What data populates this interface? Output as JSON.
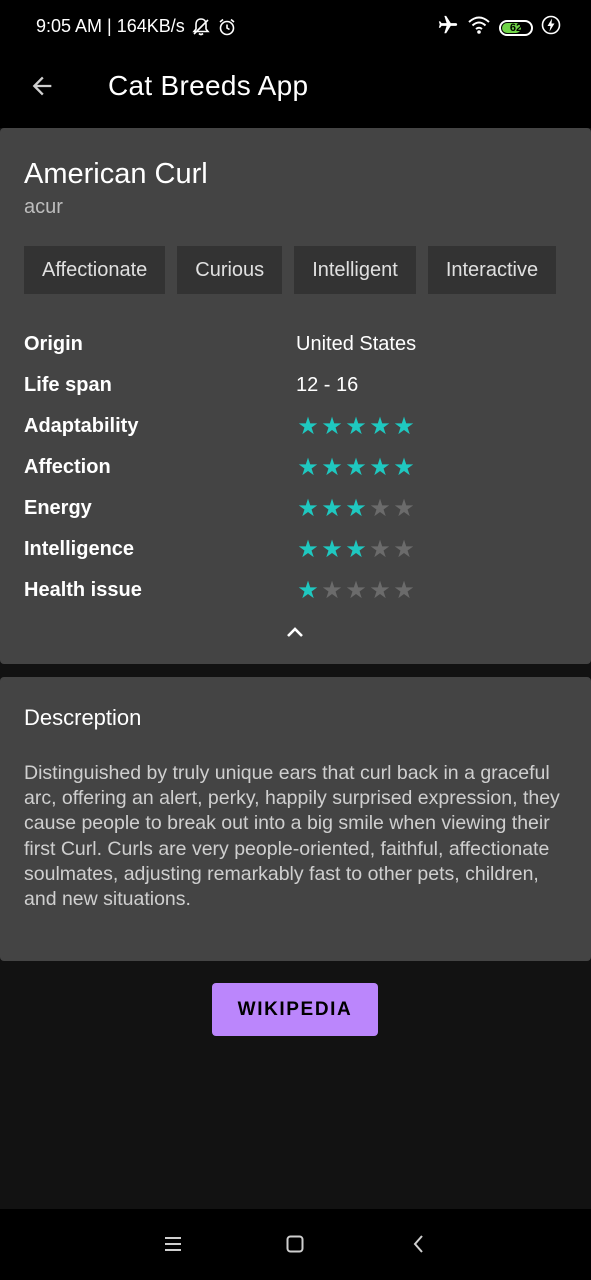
{
  "status_bar": {
    "time_speed": "9:05 AM | 164KB/s",
    "battery_level": "62",
    "icons": [
      "mute-bell-icon",
      "alarm-icon",
      "airplane-icon",
      "wifi-icon",
      "battery-icon",
      "charging-icon"
    ]
  },
  "app_bar": {
    "title": "Cat Breeds App",
    "back_icon": "arrow-back-icon"
  },
  "breed": {
    "name": "American Curl",
    "id": "acur",
    "temperament": [
      "Affectionate",
      "Curious",
      "Intelligent",
      "Interactive"
    ],
    "attributes": {
      "origin": {
        "label": "Origin",
        "value": "United States"
      },
      "life_span": {
        "label": "Life span",
        "value": "12 - 16"
      },
      "adaptability": {
        "label": "Adaptability",
        "rating": 5,
        "max": 5
      },
      "affection": {
        "label": "Affection",
        "rating": 5,
        "max": 5
      },
      "energy": {
        "label": "Energy",
        "rating": 3,
        "max": 5
      },
      "intelligence": {
        "label": "Intelligence",
        "rating": 3,
        "max": 5
      },
      "health_issue": {
        "label": "Health issue",
        "rating": 1,
        "max": 5
      }
    },
    "collapse_icon": "chevron-up-icon"
  },
  "description": {
    "title": "Descreption",
    "text": "Distinguished by truly unique ears that curl back in a graceful arc, offering an alert, perky, happily surprised expression, they cause people to break out into a big smile when viewing their first Curl. Curls are very people-oriented, faithful, affectionate soulmates, adjusting remarkably fast to other pets, children, and new situations."
  },
  "wiki_button": {
    "label": "WIKIPEDIA"
  },
  "colors": {
    "star_on": "#1fc8c0",
    "star_off": "#6b6b6b",
    "accent_button": "#bb86fc",
    "card_background": "#444444",
    "chip_background": "#333333"
  },
  "nav_bar": {
    "icons": [
      "menu-icon",
      "home-icon",
      "back-icon"
    ]
  }
}
